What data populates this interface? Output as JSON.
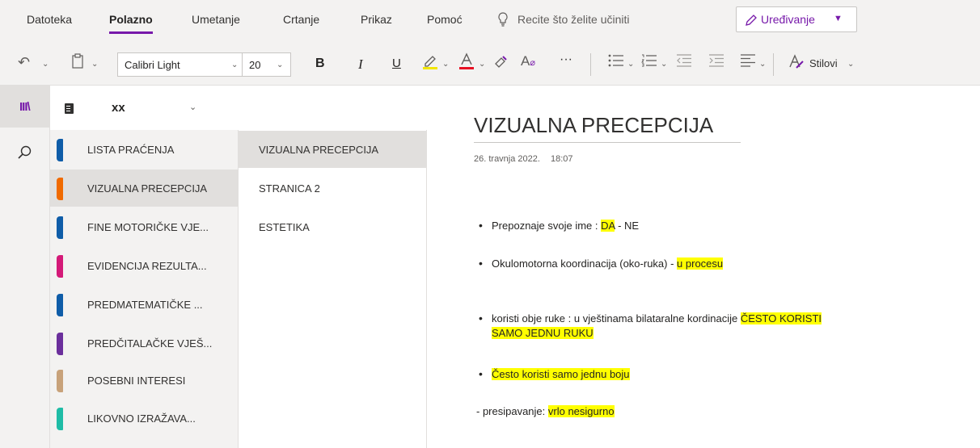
{
  "ribbon": {
    "tabs": [
      "Datoteka",
      "Polazno",
      "Umetanje",
      "Crtanje",
      "Prikaz",
      "Pomoć"
    ],
    "active_tab": "Polazno",
    "tell_me": "Recite što želite učiniti",
    "edit_mode": "Uređivanje"
  },
  "toolbar": {
    "font_name": "Calibri Light",
    "font_size": "20",
    "bold": "B",
    "italic": "I",
    "underline": "U",
    "more": "···",
    "styles": "Stilovi"
  },
  "notebook": {
    "name": "xx"
  },
  "sections": [
    {
      "label": "LISTA PRAĆENJA",
      "color": "#0f5da8"
    },
    {
      "label": "VIZUALNA PRECEPCIJA",
      "color": "#f06a00"
    },
    {
      "label": "FINE MOTORIČKE VJE...",
      "color": "#0f5da8"
    },
    {
      "label": "EVIDENCIJA REZULTA...",
      "color": "#d41a78"
    },
    {
      "label": "PREDMATEMATIČKE ...",
      "color": "#0f5da8"
    },
    {
      "label": "PREDČITALAČKE VJEŠ...",
      "color": "#6b2f9c"
    },
    {
      "label": "POSEBNI INTERESI",
      "color": "#c8a27a"
    },
    {
      "label": "LIKOVNO IZRAŽAVA...",
      "color": "#1fbca6"
    }
  ],
  "pages": [
    "VIZUALNA PRECEPCIJA",
    "STRANICA 2",
    "ESTETIKA"
  ],
  "note": {
    "title": "VIZUALNA PRECEPCIJA",
    "date": "26. travnja 2022.",
    "time": "18:07",
    "b1_text": "Prepoznaje svoje ime : ",
    "b1_hl": "DA",
    "b1_rest": " -  NE",
    "b2_text": "Okulomotorna koordinacija (oko-ruka) - ",
    "b2_hl": "u procesu",
    "b3_text": "  koristi obje ruke : u vještinama bilataralne kordinacije ",
    "b3_hl1": "ČESTO KORISTI",
    "b3_hl2": "SAMO JEDNU RUKU",
    "b4_hl": "Često koristi samo jednu boju",
    "l5_text": "- presipavanje:  ",
    "l5_hl": "vrlo nesigurno"
  }
}
